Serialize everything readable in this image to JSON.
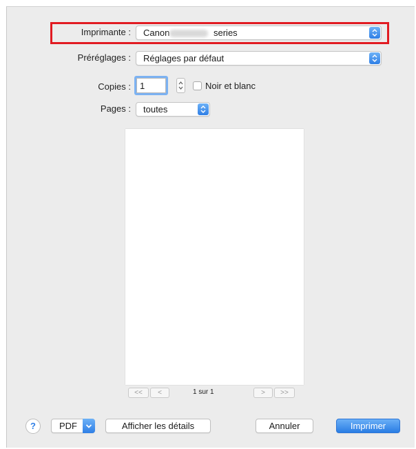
{
  "printer": {
    "label": "Imprimante :",
    "value_prefix": "Canon",
    "value_suffix": "series"
  },
  "presets": {
    "label": "Préréglages :",
    "value": "Réglages par défaut"
  },
  "copies": {
    "label": "Copies :",
    "value": "1",
    "bw_label": "Noir et blanc"
  },
  "pages": {
    "label": "Pages :",
    "value": "toutes"
  },
  "pagination": {
    "first": "<<",
    "prev": "<",
    "status": "1 sur 1",
    "next": ">",
    "last": ">>"
  },
  "footer": {
    "help": "?",
    "pdf": "PDF",
    "details": "Afficher les détails",
    "cancel": "Annuler",
    "print": "Imprimer"
  },
  "colors": {
    "accent": "#2f7fe6",
    "highlight": "#e11b22",
    "dialog_bg": "#ececec"
  }
}
